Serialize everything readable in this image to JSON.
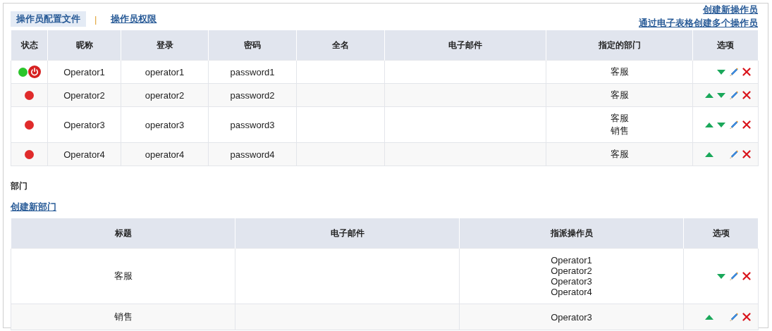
{
  "tabs": [
    {
      "label": "操作员配置文件",
      "selected": true
    },
    {
      "label": "操作员权限",
      "selected": false
    }
  ],
  "tab_separator": "|",
  "actions": [
    "创建新操作员",
    "通过电子表格创建多个操作员"
  ],
  "operators": {
    "columns": [
      "状态",
      "昵称",
      "登录",
      "密码",
      "全名",
      "电子邮件",
      "指定的部门",
      "选项"
    ],
    "rows": [
      {
        "online": true,
        "nickname": "Operator1",
        "login": "operator1",
        "password": "password1",
        "departments": [
          "客服"
        ],
        "can_move_up": false,
        "can_move_down": true
      },
      {
        "online": false,
        "nickname": "Operator2",
        "login": "operator2",
        "password": "password2",
        "departments": [
          "客服"
        ],
        "can_move_up": true,
        "can_move_down": true
      },
      {
        "online": false,
        "nickname": "Operator3",
        "login": "operator3",
        "password": "password3",
        "departments": [
          "客服",
          "销售"
        ],
        "can_move_up": true,
        "can_move_down": true
      },
      {
        "online": false,
        "nickname": "Operator4",
        "login": "operator4",
        "password": "password4",
        "departments": [
          "客服"
        ],
        "can_move_up": true,
        "can_move_down": false
      }
    ]
  },
  "departments": {
    "title": "部门",
    "create_link": "创建新部门",
    "columns": [
      "标题",
      "电子邮件",
      "指派操作员",
      "选项"
    ],
    "rows": [
      {
        "title": "客服",
        "operators": [
          "Operator1",
          "Operator2",
          "Operator3",
          "Operator4"
        ],
        "can_move_up": false,
        "can_move_down": true
      },
      {
        "title": "销售",
        "operators": [
          "Operator3"
        ],
        "can_move_up": true,
        "can_move_down": false
      }
    ]
  }
}
